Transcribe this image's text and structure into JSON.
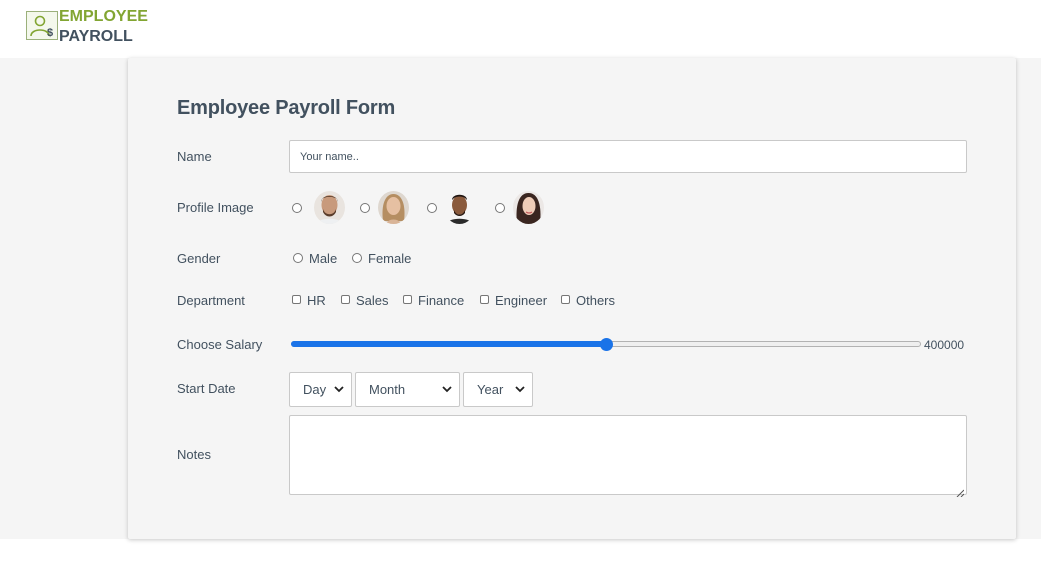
{
  "logo": {
    "icon": "user-dollar-icon",
    "line1": "EMPLOYEE",
    "line2": "PAYROLL"
  },
  "form": {
    "title": "Employee Payroll Form",
    "name": {
      "label": "Name",
      "placeholder": "Your name.."
    },
    "profile": {
      "label": "Profile Image",
      "options": [
        "avatar-man-1",
        "avatar-woman-1",
        "avatar-man-2",
        "avatar-woman-2"
      ]
    },
    "gender": {
      "label": "Gender",
      "options": [
        "Male",
        "Female"
      ]
    },
    "department": {
      "label": "Department",
      "options": [
        "HR",
        "Sales",
        "Finance",
        "Engineer",
        "Others"
      ]
    },
    "salary": {
      "label": "Choose Salary",
      "value": "400000",
      "fraction": 0.5
    },
    "start_date": {
      "label": "Start Date",
      "day": "Day",
      "month": "Month",
      "year": "Year"
    },
    "notes": {
      "label": "Notes"
    }
  },
  "colors": {
    "brand_green": "#82a532",
    "text": "#42515f",
    "accent": "#1a73e8"
  }
}
